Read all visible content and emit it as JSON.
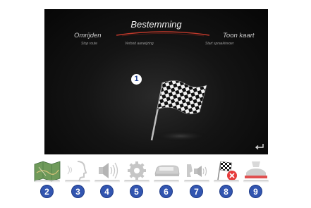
{
  "screen": {
    "title": "Bestemming",
    "left_menu": "Omrijden",
    "right_menu": "Toon kaart",
    "left_sub": "Stop route",
    "mid_sub": "Verbod aanwijzing",
    "right_sub": "Start spraakinvoer"
  },
  "callouts": {
    "flag": "1"
  },
  "toolbar": {
    "items": [
      {
        "label": "2",
        "icon": "map-icon"
      },
      {
        "label": "3",
        "icon": "voice-icon"
      },
      {
        "label": "4",
        "icon": "volume-icon"
      },
      {
        "label": "5",
        "icon": "settings-gear-icon"
      },
      {
        "label": "6",
        "icon": "vehicle-icon"
      },
      {
        "label": "7",
        "icon": "phone-volume-icon"
      },
      {
        "label": "8",
        "icon": "cancel-destination-icon"
      },
      {
        "label": "9",
        "icon": "lane-guidance-icon"
      }
    ]
  },
  "colors": {
    "screen_bg": "#0a0a0a",
    "title_arc": "#c0392b",
    "badge": "#3255b0",
    "cancel_red": "#e63b3b"
  }
}
